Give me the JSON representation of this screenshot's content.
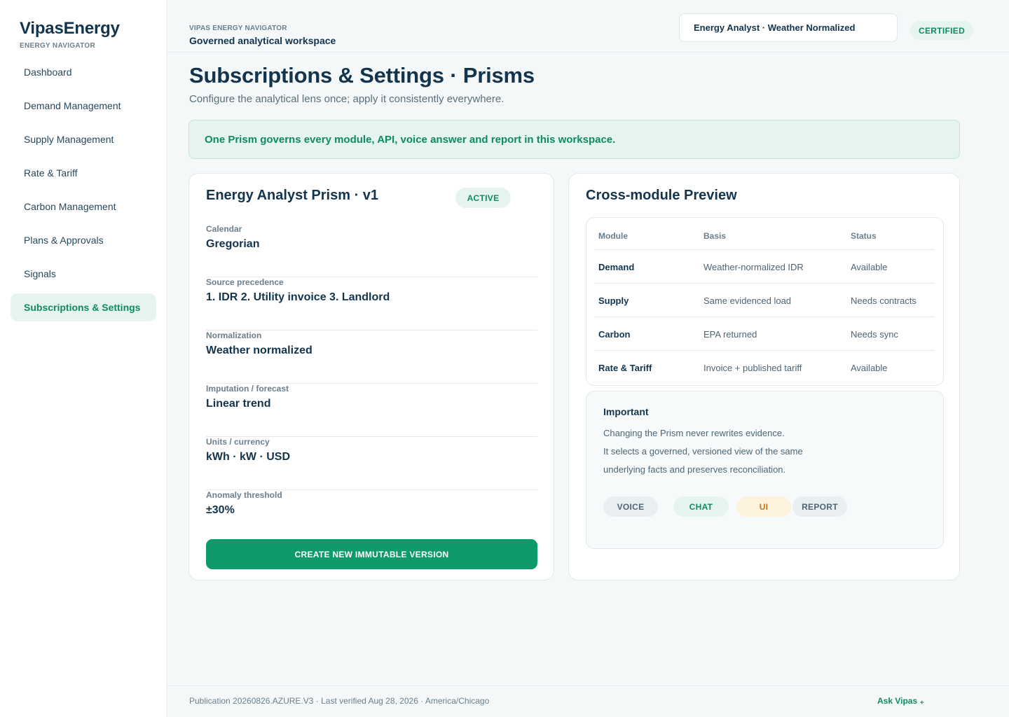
{
  "brand": {
    "name": "VipasEnergy",
    "sub": "ENERGY NAVIGATOR"
  },
  "sidebar": {
    "items": [
      {
        "label": "Dashboard",
        "active": false
      },
      {
        "label": "Demand Management",
        "active": false
      },
      {
        "label": "Supply Management",
        "active": false
      },
      {
        "label": "Rate & Tariff",
        "active": false
      },
      {
        "label": "Carbon Management",
        "active": false
      },
      {
        "label": "Plans & Approvals",
        "active": false
      },
      {
        "label": "Signals",
        "active": false
      },
      {
        "label": "Subscriptions & Settings",
        "active": true
      }
    ]
  },
  "topbar": {
    "eyebrow": "VIPAS ENERGY NAVIGATOR",
    "title": "Governed analytical workspace",
    "prism_selector": "Energy Analyst · Weather Normalized",
    "badge": "CERTIFIED"
  },
  "page": {
    "title": "Subscriptions & Settings · Prisms",
    "subtitle": "Configure the analytical lens once; apply it consistently everywhere.",
    "banner": "One Prism governs every module, API, voice answer and report in this workspace."
  },
  "prism_card": {
    "title": "Energy Analyst Prism · v1",
    "status": "ACTIVE",
    "fields": [
      {
        "label": "Calendar",
        "value": "Gregorian"
      },
      {
        "label": "Source precedence",
        "value": "1. IDR 2. Utility invoice 3. Landlord"
      },
      {
        "label": "Normalization",
        "value": "Weather normalized"
      },
      {
        "label": "Imputation / forecast",
        "value": "Linear trend"
      },
      {
        "label": "Units / currency",
        "value": "kWh · kW · USD"
      },
      {
        "label": "Anomaly threshold",
        "value": "±30%"
      }
    ],
    "button": "CREATE NEW IMMUTABLE VERSION"
  },
  "preview": {
    "title": "Cross-module Preview",
    "columns": [
      "Module",
      "Basis",
      "Status"
    ],
    "rows": [
      {
        "module": "Demand",
        "basis": "Weather-normalized IDR",
        "status": "Available"
      },
      {
        "module": "Supply",
        "basis": "Same evidenced load",
        "status": "Needs contracts"
      },
      {
        "module": "Carbon",
        "basis": "EPA returned",
        "status": "Needs sync"
      },
      {
        "module": "Rate & Tariff",
        "basis": "Invoice + published tariff",
        "status": "Available"
      }
    ],
    "important": {
      "title": "Important",
      "lines": [
        "Changing the Prism never rewrites evidence.",
        "It selects a governed, versioned view of the same",
        "underlying facts and preserves reconciliation."
      ],
      "chips": [
        {
          "label": "VOICE",
          "color": "#4d6575",
          "bg": "#e9eff1"
        },
        {
          "label": "CHAT",
          "color": "#0f8a63",
          "bg": "#e6f4ef"
        },
        {
          "label": "UI",
          "color": "#b7791f",
          "bg": "#fdf2dc"
        },
        {
          "label": "REPORT",
          "color": "#4d6575",
          "bg": "#e9eff1"
        }
      ]
    }
  },
  "footer": {
    "text": "Publication 20260826.AZURE.V3 · Last verified Aug 28, 2026 · America/Chicago",
    "ask": "Ask Vipas ₊"
  }
}
